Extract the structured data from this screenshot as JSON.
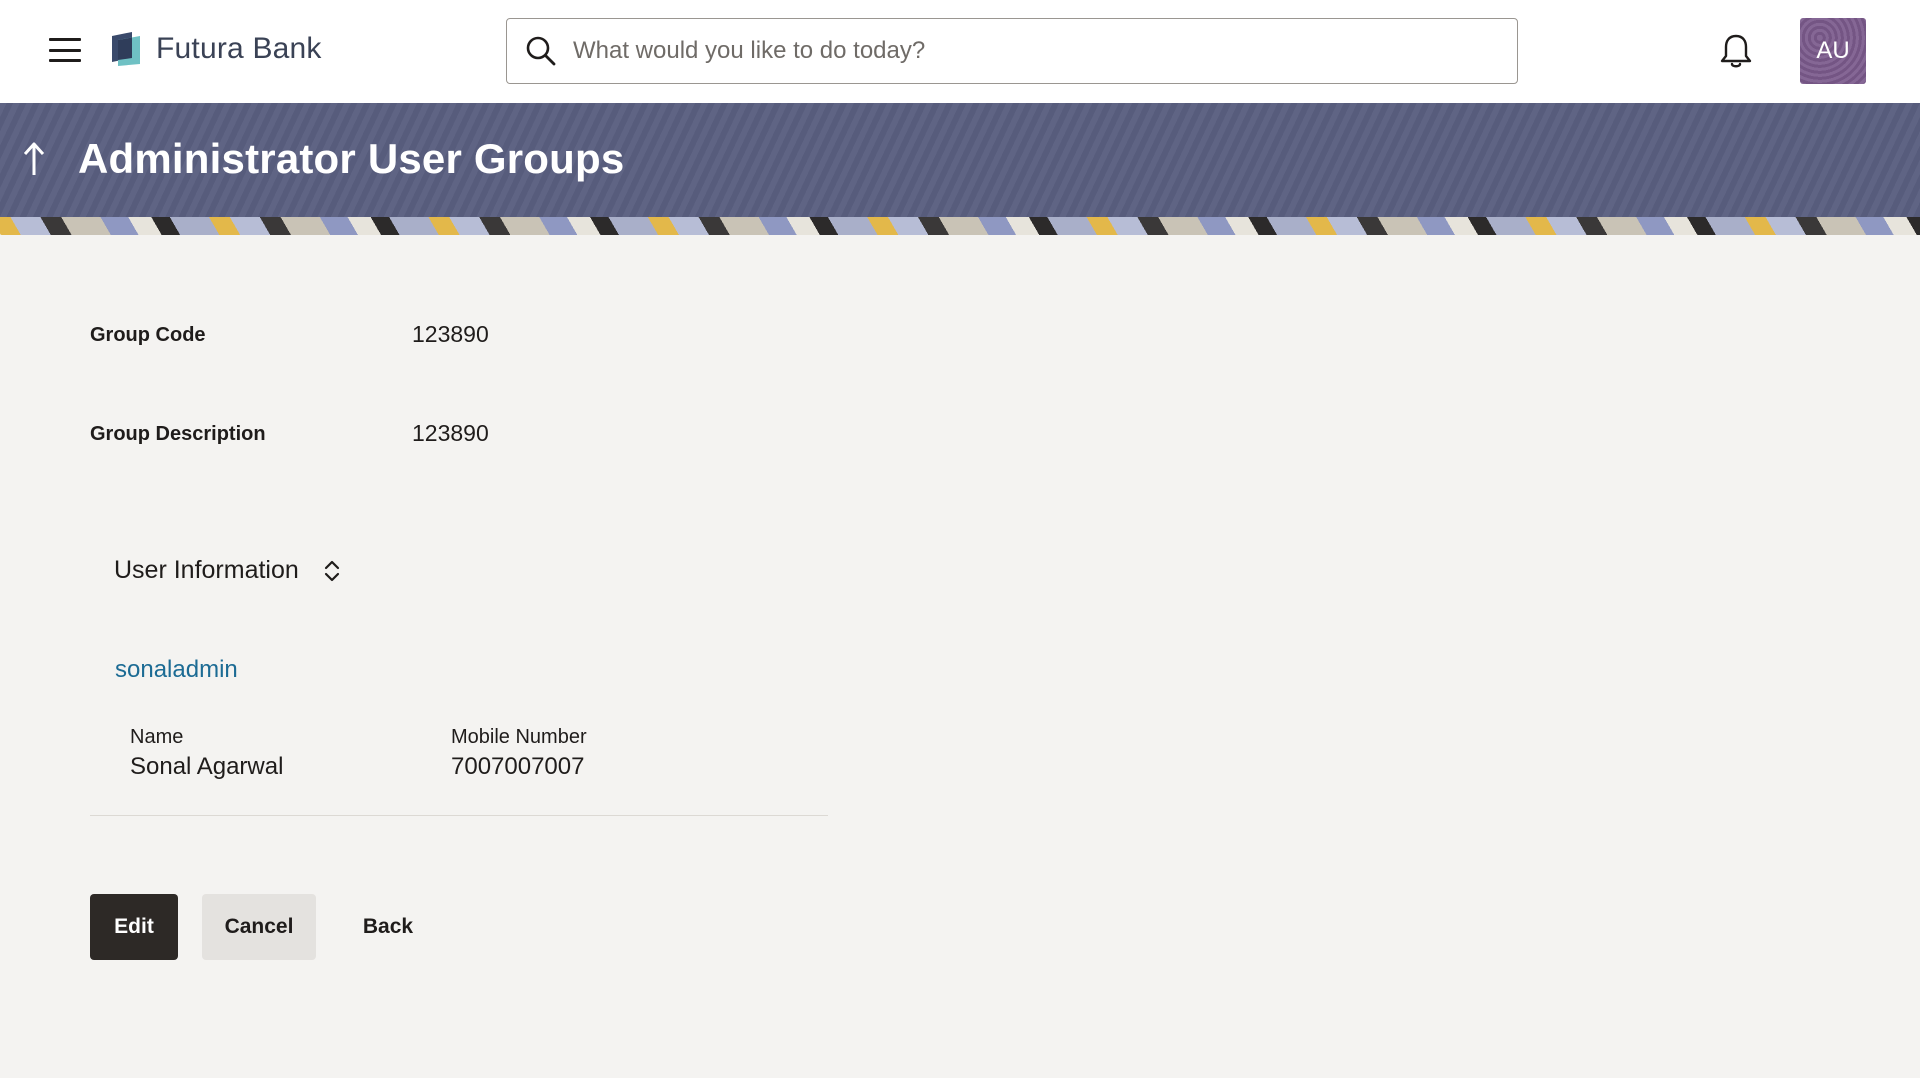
{
  "header": {
    "brand_name": "Futura Bank",
    "search_placeholder": "What would you like to do today?",
    "avatar_initials": "AU",
    "icons": [
      "menu-icon",
      "logo-icon",
      "search-icon",
      "bell-icon"
    ]
  },
  "banner": {
    "title": "Administrator User Groups"
  },
  "details": {
    "group_code_label": "Group Code",
    "group_code_value": "123890",
    "group_description_label": "Group Description",
    "group_description_value": "123890"
  },
  "user_section": {
    "title": "User Information",
    "users": [
      {
        "user_id": "sonaladmin",
        "name_label": "Name",
        "name": "Sonal Agarwal",
        "mobile_label": "Mobile Number",
        "mobile": "7007007007"
      }
    ]
  },
  "actions": {
    "edit_label": "Edit",
    "cancel_label": "Cancel",
    "back_label": "Back"
  },
  "colors": {
    "banner": "#5a5f80",
    "link": "#1c6b94",
    "primary_button": "#2d2926",
    "secondary_button": "#e4e2df",
    "avatar": "#7b5a8c",
    "page_background": "#f4f3f1"
  }
}
